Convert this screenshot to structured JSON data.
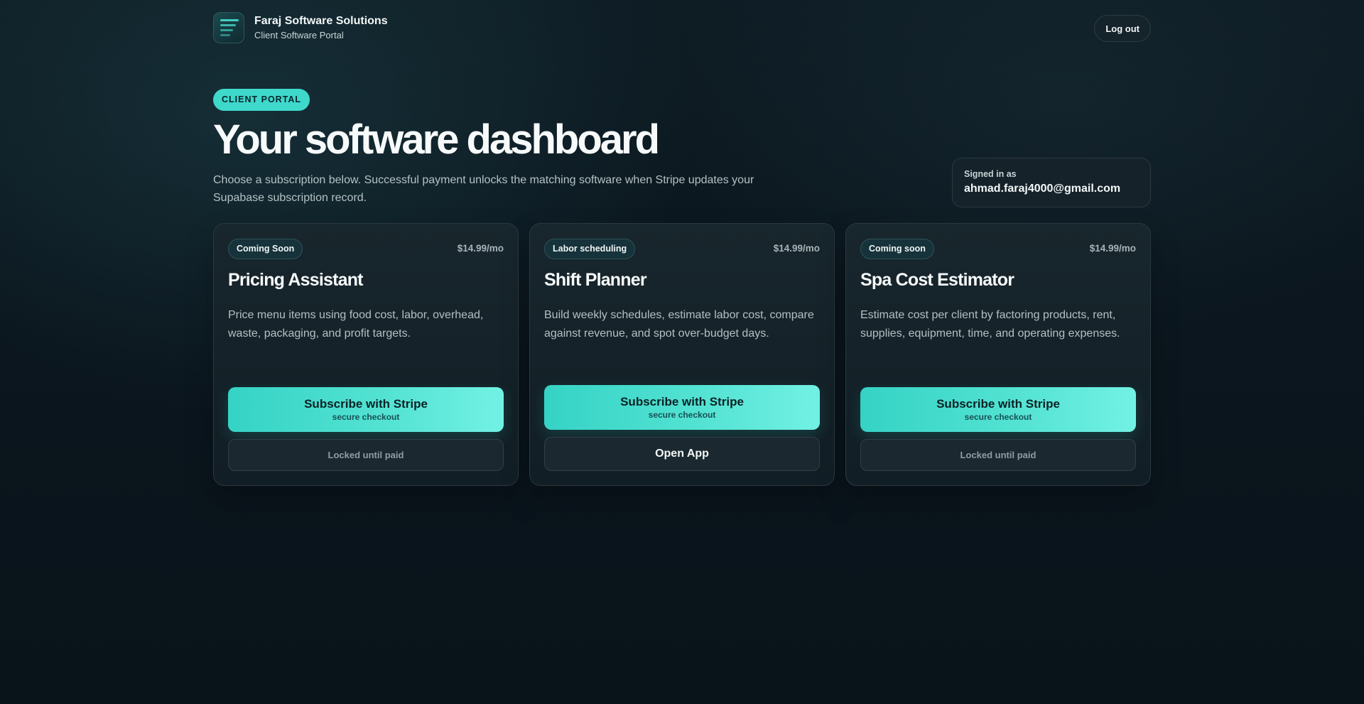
{
  "header": {
    "brand_name": "Faraj Software Solutions",
    "brand_subtitle": "Client Software Portal",
    "logout_label": "Log out"
  },
  "hero": {
    "badge": "CLIENT PORTAL",
    "title": "Your software dashboard",
    "description": "Choose a subscription below. Successful payment unlocks the matching software when Stripe updates your Supabase subscription record."
  },
  "account": {
    "label": "Signed in as",
    "email": "ahmad.faraj4000@gmail.com"
  },
  "products": [
    {
      "tag": "Coming Soon",
      "price": "$14.99/mo",
      "name": "Pricing Assistant",
      "description": "Price menu items using food cost, labor, overhead, waste, packaging, and profit targets.",
      "subscribe_label": "Subscribe with Stripe",
      "subscribe_sublabel": "secure checkout",
      "secondary_label": "Locked until paid",
      "unlocked": false
    },
    {
      "tag": "Labor scheduling",
      "price": "$14.99/mo",
      "name": "Shift Planner",
      "description": "Build weekly schedules, estimate labor cost, compare against revenue, and spot over-budget days.",
      "subscribe_label": "Subscribe with Stripe",
      "subscribe_sublabel": "secure checkout",
      "secondary_label": "Open App",
      "unlocked": true
    },
    {
      "tag": "Coming soon",
      "price": "$14.99/mo",
      "name": "Spa Cost Estimator",
      "description": "Estimate cost per client by factoring products, rent, supplies, equipment, time, and operating expenses.",
      "subscribe_label": "Subscribe with Stripe",
      "subscribe_sublabel": "secure checkout",
      "secondary_label": "Locked until paid",
      "unlocked": false
    }
  ],
  "colors": {
    "accent": "#3fd9cc",
    "background": "#0b161e"
  }
}
